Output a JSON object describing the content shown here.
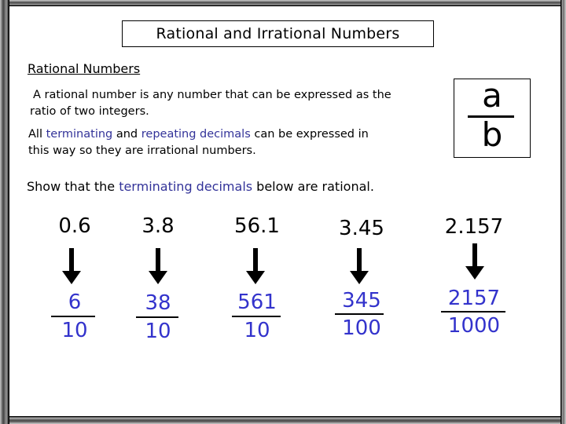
{
  "slide": {
    "title": "Rational and Irrational Numbers",
    "section_heading": "Rational Numbers",
    "definition": {
      "line1": "A rational number is any number that can be expressed as the",
      "line2": "ratio of two integers."
    },
    "statement": {
      "part1": "All ",
      "highlight1": "terminating",
      "part2": " and ",
      "highlight2": "repeating decimals",
      "part3": " can be expressed in",
      "line2": "this way so they are irrational numbers."
    },
    "ratio_box": {
      "numerator": "a",
      "denominator": "b"
    },
    "instruction": {
      "part1": "Show that the ",
      "highlight": "terminating decimals",
      "part2": " below are rational."
    },
    "conversions": [
      {
        "decimal": "0.6",
        "numerator": "6",
        "denominator": "10"
      },
      {
        "decimal": "3.8",
        "numerator": "38",
        "denominator": "10"
      },
      {
        "decimal": "56.1",
        "numerator": "561",
        "denominator": "10"
      },
      {
        "decimal": "3.45",
        "numerator": "345",
        "denominator": "100"
      },
      {
        "decimal": "2.157",
        "numerator": "2157",
        "denominator": "1000"
      }
    ],
    "colors": {
      "highlight_text": "#333399",
      "fraction_text": "#3333cc",
      "body_text": "#000000"
    }
  }
}
